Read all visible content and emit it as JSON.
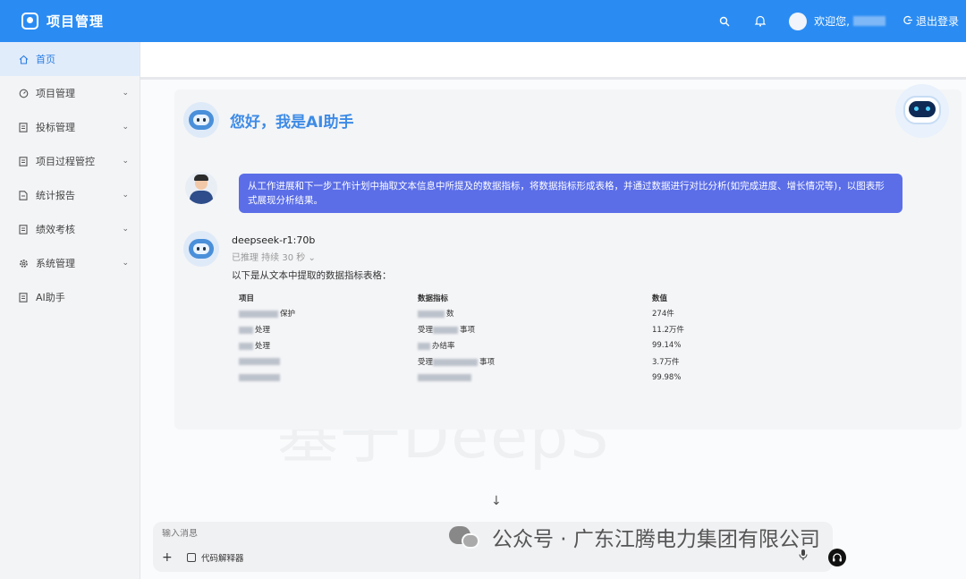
{
  "app": {
    "title": "项目管理"
  },
  "header": {
    "welcome": "欢迎您,",
    "logout": "退出登录"
  },
  "sidebar": {
    "items": [
      {
        "label": "首页",
        "icon": "home-icon",
        "active": true,
        "has_arrow": false
      },
      {
        "label": "项目管理",
        "icon": "dashboard-icon",
        "active": false,
        "has_arrow": true
      },
      {
        "label": "投标管理",
        "icon": "document-icon",
        "active": false,
        "has_arrow": true
      },
      {
        "label": "项目过程管控",
        "icon": "document-icon",
        "active": false,
        "has_arrow": true
      },
      {
        "label": "统计报告",
        "icon": "file-icon",
        "active": false,
        "has_arrow": true
      },
      {
        "label": "绩效考核",
        "icon": "document-icon",
        "active": false,
        "has_arrow": true
      },
      {
        "label": "系统管理",
        "icon": "gear-icon",
        "active": false,
        "has_arrow": true
      },
      {
        "label": "AI助手",
        "icon": "document-icon",
        "active": false,
        "has_arrow": false
      }
    ]
  },
  "chat": {
    "greeting": "您好，我是AI助手",
    "user_message": "从工作进展和下一步工作计划中抽取文本信息中所提及的数据指标，将数据指标形成表格，并通过数据进行对比分析(如完成进度、增长情况等)，以图表形式展现分析结果。",
    "model_name": "deepseek-r1:70b",
    "reasoning_status": "已推理 持续 30 秒",
    "intro": "以下是从文本中提取的数据指标表格：",
    "table": {
      "headers": [
        "项目",
        "数据指标",
        "数值"
      ],
      "rows": [
        {
          "c1_suffix": "保护",
          "c2_prefix": "",
          "c2_suffix": "数",
          "value": "274件"
        },
        {
          "c1_suffix": "处理",
          "c2_prefix": "受理",
          "c2_suffix": "事项",
          "value": "11.2万件"
        },
        {
          "c1_suffix": "处理",
          "c2_prefix": "",
          "c2_suffix": "办结率",
          "value": "99.14%"
        },
        {
          "c1_suffix": "",
          "c2_prefix": "受理",
          "c2_suffix": "事项",
          "value": "3.7万件"
        },
        {
          "c1_suffix": "",
          "c2_prefix": "",
          "c2_suffix": "",
          "value": "99.98%"
        }
      ]
    },
    "watermark": "基于DeepS"
  },
  "input": {
    "placeholder": "输入消息",
    "code_interpreter": "代码解释器"
  },
  "footer_watermark": "公众号 · 广东江腾电力集团有限公司",
  "colors": {
    "header_bg": "#2a8cf3",
    "sidebar_active_bg": "#e1ecfb",
    "user_bubble": "#5b6ee8",
    "greeting": "#3d8be6"
  }
}
